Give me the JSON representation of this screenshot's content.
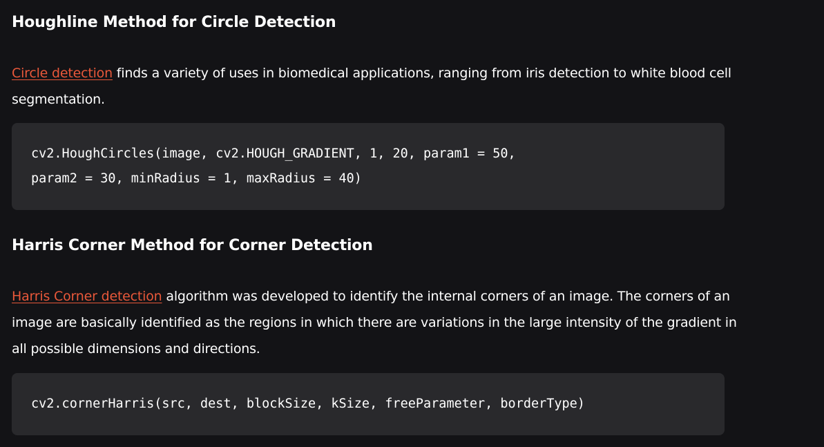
{
  "sections": [
    {
      "heading": "Houghline Method for Circle Detection",
      "link_text": "Circle detection",
      "paragraph_rest": " finds a variety of uses in biomedical applications, ranging from iris detection to white blood cell segmentation.",
      "code_lines": [
        "cv2.HoughCircles(image, cv2.HOUGH_GRADIENT, 1, 20, param1 = 50,",
        "param2 = 30, minRadius = 1, maxRadius = 40)"
      ]
    },
    {
      "heading": "Harris Corner Method for Corner Detection",
      "link_text": "Harris Corner detection",
      "paragraph_rest": " algorithm was developed to identify the internal corners of an image. The corners of an image are basically identified as the regions in which there are variations in the large intensity of the gradient in all possible dimensions and directions.",
      "code_lines": [
        "cv2.cornerHarris(src, dest, blockSize, kSize, freeParameter, borderType)"
      ]
    }
  ],
  "colors": {
    "background": "#131316",
    "code_background": "#29292c",
    "link": "#e9583a",
    "text": "#ffffff"
  }
}
